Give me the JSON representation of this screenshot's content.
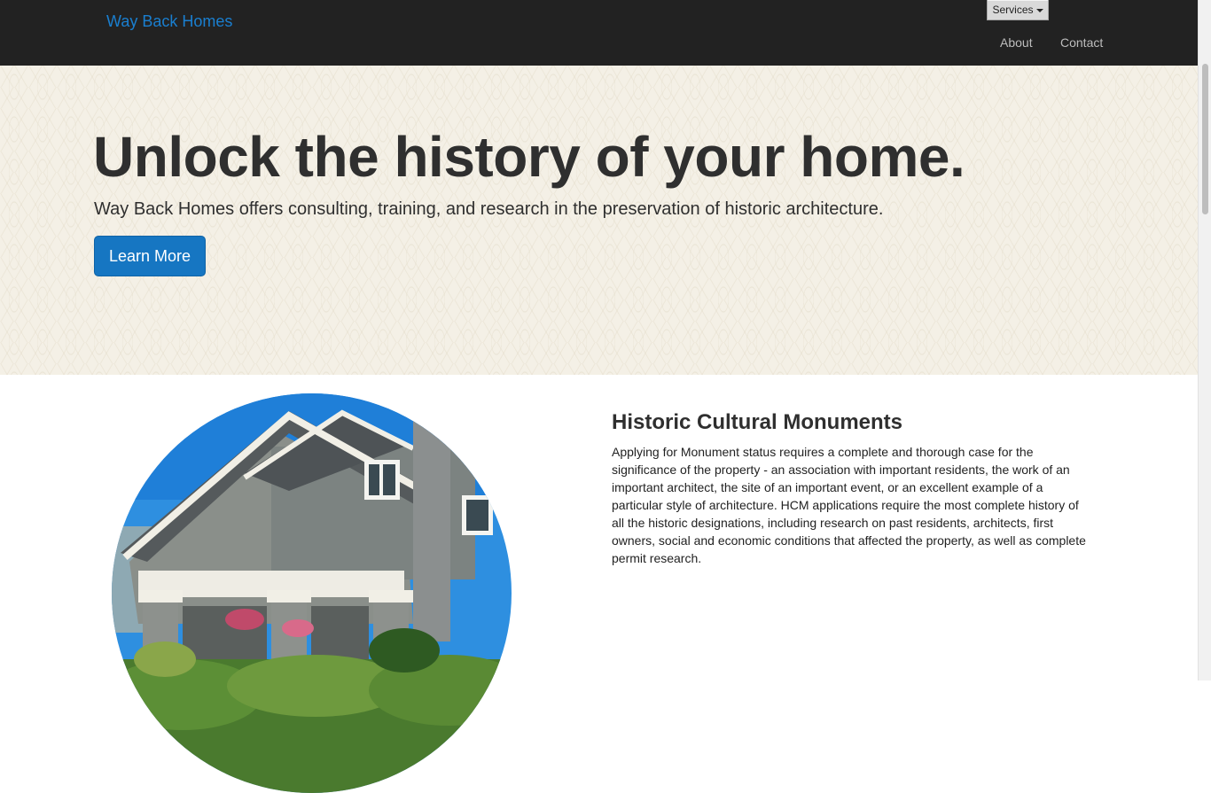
{
  "navbar": {
    "brand": "Way Back Homes",
    "services_label": "Services",
    "links": [
      "About",
      "Contact"
    ]
  },
  "hero": {
    "title": "Unlock the history of your home.",
    "subtitle": "Way Back Homes offers consulting, training, and research in the preservation of historic architecture.",
    "button_label": "Learn More"
  },
  "section": {
    "title": "Historic Cultural Monuments",
    "body": "Applying for Monument status requires a complete and thorough case for the significance of the property - an association with important residents, the work of an important architect, the site of an important event, or an excellent example of a particular style of architecture. HCM applications require the most complete history of all the historic designations, including research on past residents, architects, first owners, social and economic conditions that affected the property, as well as complete permit research."
  },
  "colors": {
    "navbar_bg": "#222222",
    "brand": "#1a7fd0",
    "hero_bg": "#f4f0e6",
    "button_bg": "#1676c2"
  },
  "icons": {
    "services_caret": "caret-down-icon"
  }
}
